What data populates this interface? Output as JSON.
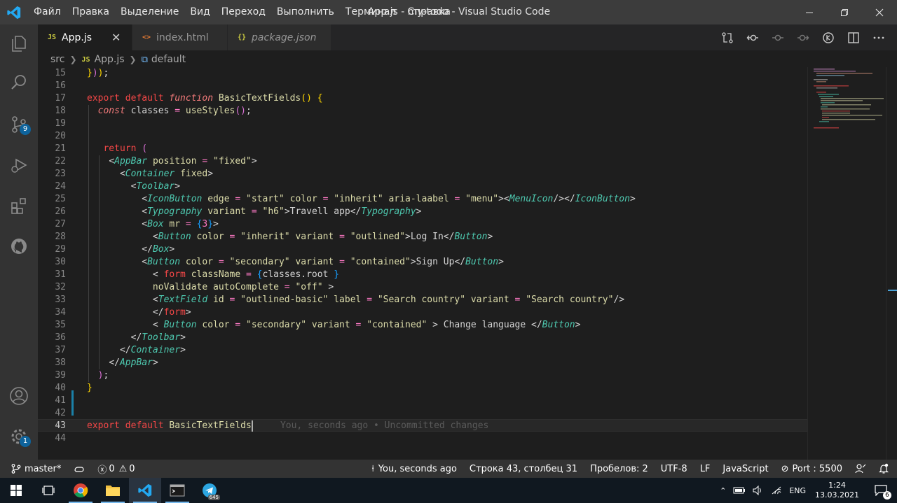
{
  "titlebar": {
    "menu": [
      "Файл",
      "Правка",
      "Выделение",
      "Вид",
      "Переход",
      "Выполнить",
      "Терминал",
      "Справка"
    ],
    "title": "App.js - my-todo - Visual Studio Code"
  },
  "activity": {
    "scm_badge": "9",
    "settings_badge": "1"
  },
  "tabs": [
    {
      "label": "App.js",
      "icon": "JS",
      "active": true
    },
    {
      "label": "index.html",
      "icon": "<>"
    },
    {
      "label": "package.json",
      "icon": "{}"
    }
  ],
  "breadcrumb": {
    "folder": "src",
    "js_icon": "JS",
    "file": "App.js",
    "symbol": "default"
  },
  "editor": {
    "line_numbers": [
      "15",
      "16",
      "17",
      "18",
      "19",
      "20",
      "21",
      "22",
      "23",
      "24",
      "25",
      "26",
      "27",
      "28",
      "29",
      "30",
      "31",
      "32",
      "33",
      "34",
      "35",
      "36",
      "37",
      "38",
      "39",
      "40",
      "41",
      "42",
      "43",
      "44"
    ],
    "blame": "You, seconds ago • Uncommitted changes"
  },
  "status": {
    "branch": "master*",
    "errors": "0",
    "warnings": "0",
    "blame": "You, seconds ago",
    "position": "Строка 43, столбец 31",
    "spaces": "Пробелов: 2",
    "encoding": "UTF-8",
    "eol": "LF",
    "language": "JavaScript",
    "port": "Port : 5500"
  },
  "taskbar": {
    "lang": "ENG",
    "time": "1:24",
    "date": "13.03.2021",
    "notifications": "6",
    "telegram_badge": "645"
  }
}
